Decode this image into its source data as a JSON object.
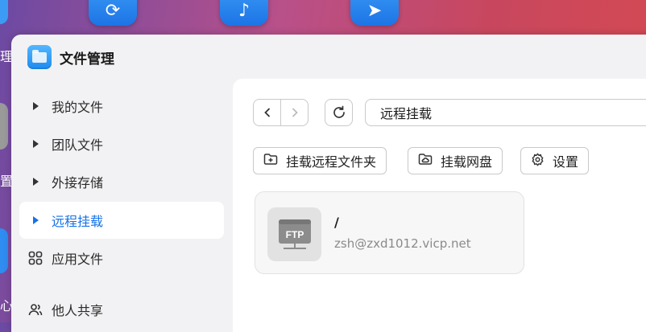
{
  "desktop": {
    "left_labels": [
      "理",
      "置",
      "心"
    ]
  },
  "app": {
    "title": "文件管理"
  },
  "sidebar": {
    "items": [
      {
        "label": "我的文件",
        "icon": "caret-right-icon"
      },
      {
        "label": "团队文件",
        "icon": "caret-right-icon"
      },
      {
        "label": "外接存储",
        "icon": "caret-right-icon"
      },
      {
        "label": "远程挂载",
        "icon": "caret-right-icon",
        "active": true
      },
      {
        "label": "应用文件",
        "icon": "apps-grid-icon"
      },
      {
        "label": "他人共享",
        "icon": "users-icon"
      }
    ]
  },
  "toolbar": {
    "path": "远程挂载",
    "buttons": [
      {
        "label": "挂载远程文件夹",
        "icon": "folder-plus-icon"
      },
      {
        "label": "挂载网盘",
        "icon": "cloud-folder-icon"
      },
      {
        "label": "设置",
        "icon": "gear-icon"
      }
    ]
  },
  "mounts": [
    {
      "name": "/",
      "host": "zsh@zxd1012.vicp.net",
      "badge": "FTP"
    }
  ],
  "colors": {
    "accent": "#1672e8",
    "sidebar_bg": "#f2f2f4",
    "card_bg": "#f7f7f7"
  }
}
